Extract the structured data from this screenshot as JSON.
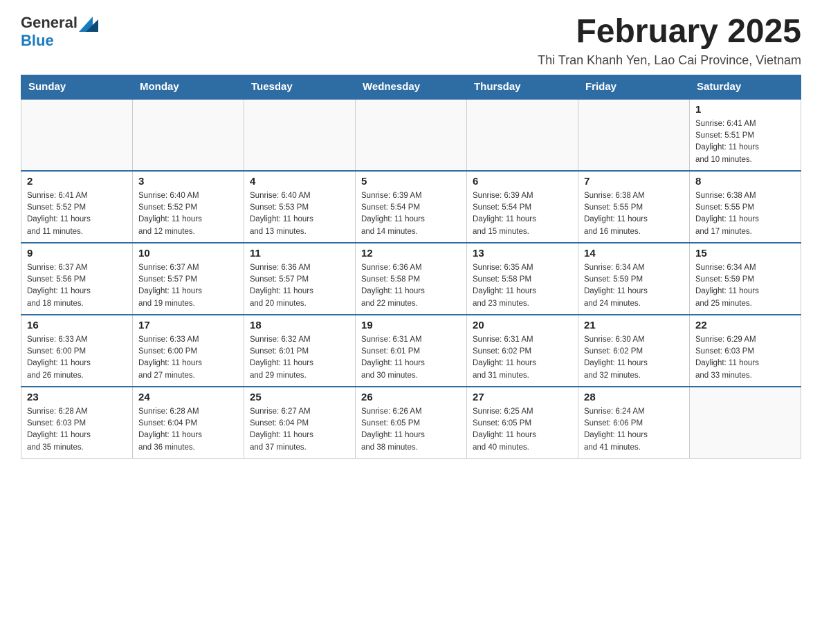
{
  "header": {
    "logo_general": "General",
    "logo_blue": "Blue",
    "month_title": "February 2025",
    "location": "Thi Tran Khanh Yen, Lao Cai Province, Vietnam"
  },
  "days_of_week": [
    "Sunday",
    "Monday",
    "Tuesday",
    "Wednesday",
    "Thursday",
    "Friday",
    "Saturday"
  ],
  "weeks": [
    {
      "days": [
        {
          "number": "",
          "info": ""
        },
        {
          "number": "",
          "info": ""
        },
        {
          "number": "",
          "info": ""
        },
        {
          "number": "",
          "info": ""
        },
        {
          "number": "",
          "info": ""
        },
        {
          "number": "",
          "info": ""
        },
        {
          "number": "1",
          "info": "Sunrise: 6:41 AM\nSunset: 5:51 PM\nDaylight: 11 hours\nand 10 minutes."
        }
      ]
    },
    {
      "days": [
        {
          "number": "2",
          "info": "Sunrise: 6:41 AM\nSunset: 5:52 PM\nDaylight: 11 hours\nand 11 minutes."
        },
        {
          "number": "3",
          "info": "Sunrise: 6:40 AM\nSunset: 5:52 PM\nDaylight: 11 hours\nand 12 minutes."
        },
        {
          "number": "4",
          "info": "Sunrise: 6:40 AM\nSunset: 5:53 PM\nDaylight: 11 hours\nand 13 minutes."
        },
        {
          "number": "5",
          "info": "Sunrise: 6:39 AM\nSunset: 5:54 PM\nDaylight: 11 hours\nand 14 minutes."
        },
        {
          "number": "6",
          "info": "Sunrise: 6:39 AM\nSunset: 5:54 PM\nDaylight: 11 hours\nand 15 minutes."
        },
        {
          "number": "7",
          "info": "Sunrise: 6:38 AM\nSunset: 5:55 PM\nDaylight: 11 hours\nand 16 minutes."
        },
        {
          "number": "8",
          "info": "Sunrise: 6:38 AM\nSunset: 5:55 PM\nDaylight: 11 hours\nand 17 minutes."
        }
      ]
    },
    {
      "days": [
        {
          "number": "9",
          "info": "Sunrise: 6:37 AM\nSunset: 5:56 PM\nDaylight: 11 hours\nand 18 minutes."
        },
        {
          "number": "10",
          "info": "Sunrise: 6:37 AM\nSunset: 5:57 PM\nDaylight: 11 hours\nand 19 minutes."
        },
        {
          "number": "11",
          "info": "Sunrise: 6:36 AM\nSunset: 5:57 PM\nDaylight: 11 hours\nand 20 minutes."
        },
        {
          "number": "12",
          "info": "Sunrise: 6:36 AM\nSunset: 5:58 PM\nDaylight: 11 hours\nand 22 minutes."
        },
        {
          "number": "13",
          "info": "Sunrise: 6:35 AM\nSunset: 5:58 PM\nDaylight: 11 hours\nand 23 minutes."
        },
        {
          "number": "14",
          "info": "Sunrise: 6:34 AM\nSunset: 5:59 PM\nDaylight: 11 hours\nand 24 minutes."
        },
        {
          "number": "15",
          "info": "Sunrise: 6:34 AM\nSunset: 5:59 PM\nDaylight: 11 hours\nand 25 minutes."
        }
      ]
    },
    {
      "days": [
        {
          "number": "16",
          "info": "Sunrise: 6:33 AM\nSunset: 6:00 PM\nDaylight: 11 hours\nand 26 minutes."
        },
        {
          "number": "17",
          "info": "Sunrise: 6:33 AM\nSunset: 6:00 PM\nDaylight: 11 hours\nand 27 minutes."
        },
        {
          "number": "18",
          "info": "Sunrise: 6:32 AM\nSunset: 6:01 PM\nDaylight: 11 hours\nand 29 minutes."
        },
        {
          "number": "19",
          "info": "Sunrise: 6:31 AM\nSunset: 6:01 PM\nDaylight: 11 hours\nand 30 minutes."
        },
        {
          "number": "20",
          "info": "Sunrise: 6:31 AM\nSunset: 6:02 PM\nDaylight: 11 hours\nand 31 minutes."
        },
        {
          "number": "21",
          "info": "Sunrise: 6:30 AM\nSunset: 6:02 PM\nDaylight: 11 hours\nand 32 minutes."
        },
        {
          "number": "22",
          "info": "Sunrise: 6:29 AM\nSunset: 6:03 PM\nDaylight: 11 hours\nand 33 minutes."
        }
      ]
    },
    {
      "days": [
        {
          "number": "23",
          "info": "Sunrise: 6:28 AM\nSunset: 6:03 PM\nDaylight: 11 hours\nand 35 minutes."
        },
        {
          "number": "24",
          "info": "Sunrise: 6:28 AM\nSunset: 6:04 PM\nDaylight: 11 hours\nand 36 minutes."
        },
        {
          "number": "25",
          "info": "Sunrise: 6:27 AM\nSunset: 6:04 PM\nDaylight: 11 hours\nand 37 minutes."
        },
        {
          "number": "26",
          "info": "Sunrise: 6:26 AM\nSunset: 6:05 PM\nDaylight: 11 hours\nand 38 minutes."
        },
        {
          "number": "27",
          "info": "Sunrise: 6:25 AM\nSunset: 6:05 PM\nDaylight: 11 hours\nand 40 minutes."
        },
        {
          "number": "28",
          "info": "Sunrise: 6:24 AM\nSunset: 6:06 PM\nDaylight: 11 hours\nand 41 minutes."
        },
        {
          "number": "",
          "info": ""
        }
      ]
    }
  ]
}
